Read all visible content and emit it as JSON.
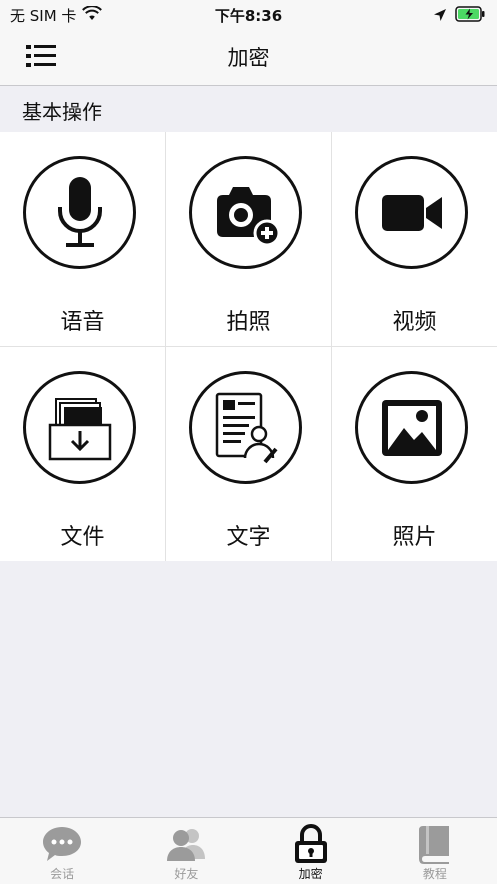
{
  "status_bar": {
    "carrier": "无 SIM 卡",
    "time": "下午8:36"
  },
  "nav": {
    "title": "加密"
  },
  "section": {
    "title": "基本操作"
  },
  "grid": [
    {
      "label": "语音",
      "icon": "microphone-icon"
    },
    {
      "label": "拍照",
      "icon": "camera-add-icon"
    },
    {
      "label": "视频",
      "icon": "video-camera-icon"
    },
    {
      "label": "文件",
      "icon": "file-tray-icon"
    },
    {
      "label": "文字",
      "icon": "document-person-icon"
    },
    {
      "label": "照片",
      "icon": "photo-icon"
    }
  ],
  "tabs": [
    {
      "label": "会话",
      "icon": "chat-bubble-icon",
      "active": false
    },
    {
      "label": "好友",
      "icon": "friends-icon",
      "active": false
    },
    {
      "label": "加密",
      "icon": "lock-icon",
      "active": true
    },
    {
      "label": "教程",
      "icon": "book-icon",
      "active": false
    }
  ],
  "colors": {
    "accent": "#111111",
    "inactive": "#9b9b9b",
    "background": "#efeff4",
    "battery": "#4cd964"
  }
}
